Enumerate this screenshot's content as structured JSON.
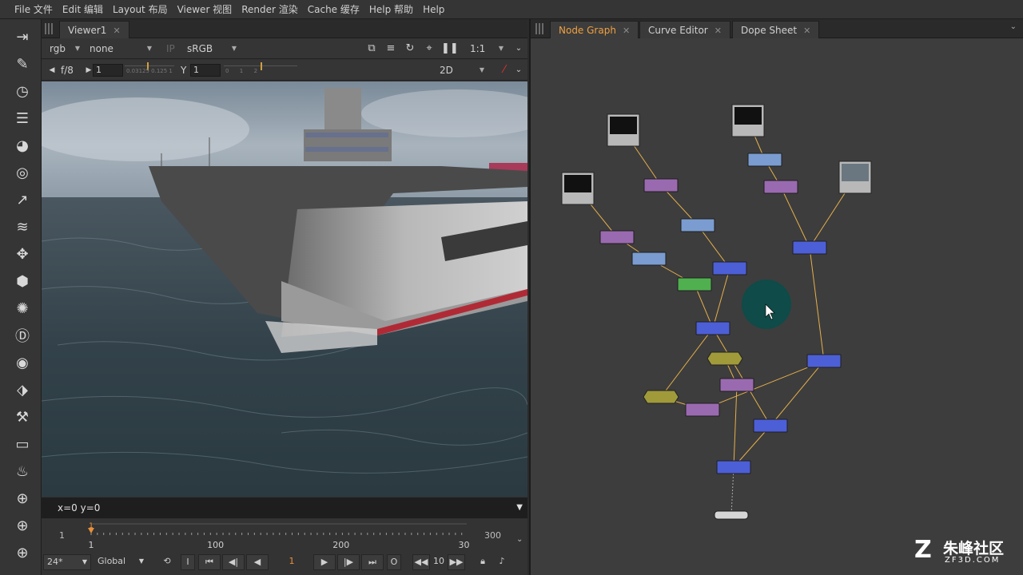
{
  "menu": [
    "File 文件",
    "Edit 编辑",
    "Layout 布局",
    "Viewer 视图",
    "Render 渲染",
    "Cache 缓存",
    "Help 帮助",
    "Help"
  ],
  "toolbar_icons": [
    "pointer-icon",
    "brush-icon",
    "clock-icon",
    "layers-icon",
    "color-wheel-icon",
    "circle-icon",
    "channel-icon",
    "stack-icon",
    "transform-icon",
    "cube-icon",
    "particles-icon",
    "deep-icon",
    "eye-icon",
    "tag-icon",
    "wrench-icon",
    "box-icon",
    "fire-icon",
    "globe-icon",
    "globe-icon",
    "globe-icon"
  ],
  "viewer": {
    "tab_label": "Viewer1",
    "channels": "rgb",
    "alpha": "none",
    "ip": "IP",
    "colorspace": "sRGB",
    "zoom": "1:1",
    "fstop": "f/8",
    "gain": "1",
    "gain_ticks": "0.03125  0.125  1",
    "y_label": "Y",
    "gamma": "1",
    "gamma_ticks": "0      1      2",
    "view_mode": "2D",
    "status": "x=0 y=0"
  },
  "timeline": {
    "start": "1",
    "end": "300",
    "marker": "1",
    "ticks": [
      "1",
      "100",
      "200",
      "300"
    ],
    "fps": "24*",
    "scope": "Global",
    "current_frame": "1",
    "step": "10",
    "current_fraction": 0.0
  },
  "graph": {
    "tabs": [
      {
        "label": "Node Graph",
        "active": true
      },
      {
        "label": "Curve Editor",
        "active": false
      },
      {
        "label": "Dope Sheet",
        "active": false
      }
    ],
    "node_colors": {
      "read": "#b8b8b8",
      "grade": "#9a6ab0",
      "transform": "#7b9cd0",
      "merge": "#4c5fd6",
      "keyer": "#50b050",
      "dot": "#a09a3a",
      "write": "#d6d6d6"
    },
    "cursor_color": "#0f4b48"
  },
  "watermark": {
    "text": "朱峰社区",
    "site": "ZF3D.COM"
  }
}
